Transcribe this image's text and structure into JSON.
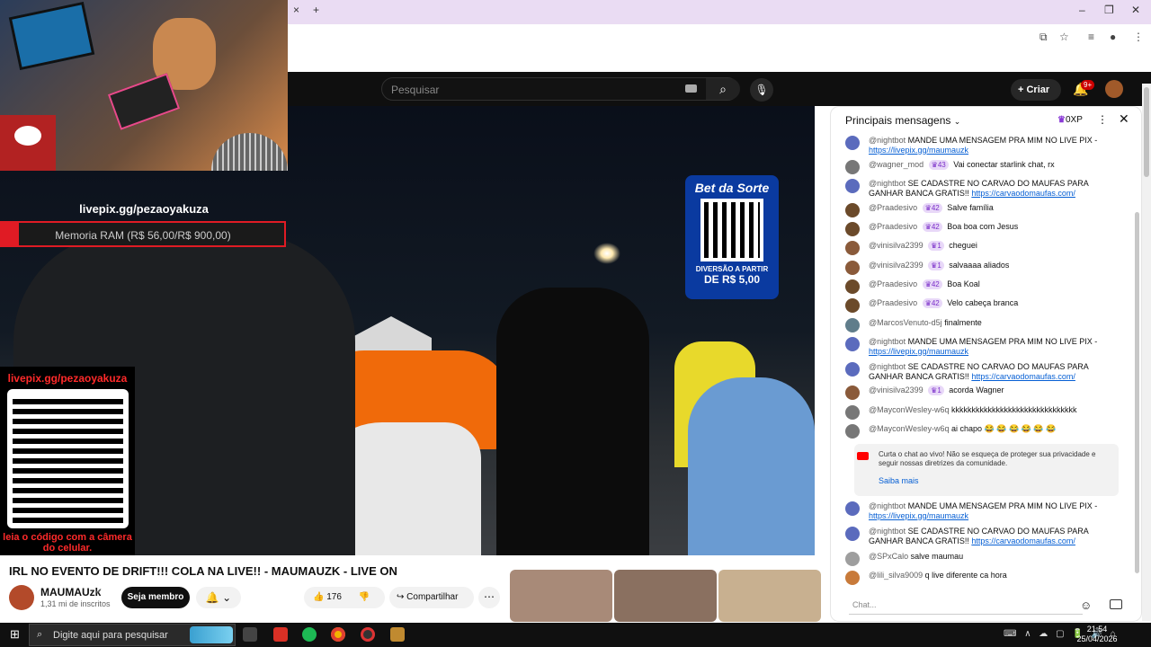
{
  "browser": {
    "tab_close": "×",
    "new_tab": "+",
    "window_controls": {
      "minimize": "–",
      "restore": "❐",
      "close": "✕"
    }
  },
  "youtube": {
    "search_placeholder": "Pesquisar",
    "create_label": "Criar",
    "notif_count": "9+"
  },
  "overlay": {
    "livepix_url": "livepix.gg/pezaoyakuza",
    "goal_text": "Memoria RAM (R$ 56,00/R$ 900,00)",
    "goal_progress": 0.062,
    "qr_url": "livepix.gg/pezaoyakuza",
    "qr_caption": "leia o código com a câmera do celular."
  },
  "bet_ad": {
    "brand": "Bet da Sorte",
    "line1": "DIVERSÃO A PARTIR",
    "line2": "DE R$ 5,00"
  },
  "video": {
    "title": "IRL NO EVENTO DE DRIFT!!! COLA NA LIVE!! - MAUMAUZK - LIVE ON",
    "channel_name": "MAUMAUzk",
    "subscribers": "1,31 mi de inscritos",
    "join_label": "Seja membro",
    "likes": "176",
    "share_label": "Compartilhar"
  },
  "chat": {
    "header": "Principais mensagens",
    "points": "0XP",
    "input_placeholder": "Chat...",
    "messages": [
      {
        "author": "@nightbot",
        "text": "MANDE UMA MENSAGEM PRA MIM NO LIVE PIX -",
        "link": "https://livepix.gg/maumauzk"
      },
      {
        "author": "@wagner_mod",
        "badge": "43",
        "text": "Vai conectar starlink chat, rx"
      },
      {
        "author": "@nightbot",
        "text": "SE CADASTRE NO CARVAO DO MAUFAS PARA GANHAR BANCA GRATIS!!",
        "link": "https://carvaodomaufas.com/"
      },
      {
        "author": "@Praadesivo",
        "badge": "42",
        "text": "Salve família"
      },
      {
        "author": "@Praadesivo",
        "badge": "42",
        "text": "Boa boa com Jesus"
      },
      {
        "author": "@vinisilva2399",
        "badge": "1",
        "text": "cheguei"
      },
      {
        "author": "@vinisilva2399",
        "badge": "1",
        "text": "salvaaaa aliados"
      },
      {
        "author": "@Praadesivo",
        "badge": "42",
        "text": "Boa Koal"
      },
      {
        "author": "@Praadesivo",
        "badge": "42",
        "text": "Velo cabeça branca"
      },
      {
        "author": "@MarcosVenuto-d5j",
        "text": "finalmente"
      },
      {
        "author": "@nightbot",
        "text": "MANDE UMA MENSAGEM PRA MIM NO LIVE PIX -",
        "link": "https://livepix.gg/maumauzk"
      },
      {
        "author": "@nightbot",
        "text": "SE CADASTRE NO CARVAO DO MAUFAS PARA GANHAR BANCA GRATIS!!",
        "link": "https://carvaodomaufas.com/"
      },
      {
        "author": "@vinisilva2399",
        "badge": "1",
        "text": "acorda Wagner"
      },
      {
        "author": "@MayconWesley-w6q",
        "text": "kkkkkkkkkkkkkkkkkkkkkkkkkkkkkkk"
      },
      {
        "author": "@MayconWesley-w6q",
        "text": "ai chapo 😂 😂 😂 😂 😂 😂"
      },
      {
        "author": "@nightbot",
        "text": "MANDE UMA MENSAGEM PRA MIM NO LIVE PIX -",
        "link": "https://livepix.gg/maumauzk"
      },
      {
        "author": "@nightbot",
        "text": "SE CADASTRE NO CARVAO DO MAUFAS PARA GANHAR BANCA GRATIS!!",
        "link": "https://carvaodomaufas.com/"
      },
      {
        "author": "@SPxCalo",
        "text": "salve maumau"
      },
      {
        "author": "@lili_silva9009",
        "text": "q live diferente ca hora"
      }
    ],
    "notice_text": "Curta o chat ao vivo! Não se esqueça de proteger sua privacidade e seguir nossas diretrizes da comunidade.",
    "notice_link": "Saiba mais"
  },
  "taskbar": {
    "search_placeholder": "Digite aqui para pesquisar",
    "time": "21:54",
    "date": "25/04/2026"
  }
}
